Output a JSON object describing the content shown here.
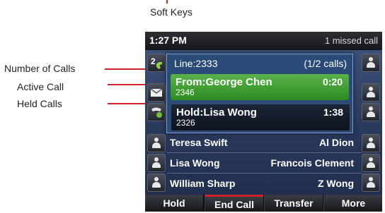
{
  "header": {
    "title": "Soft Keys"
  },
  "callouts": [
    {
      "label": "Number of Calls"
    },
    {
      "label": "Active Call"
    },
    {
      "label": "Held Calls"
    }
  ],
  "status": {
    "time": "1:27 PM",
    "missed": "1 missed call"
  },
  "line_badge": "2",
  "panel": {
    "line": "Line:2333",
    "calls": "(1/2 calls)",
    "active": {
      "name": "From:George Chen",
      "number": "2346",
      "time": "0:20"
    },
    "held": {
      "name": "Hold:Lisa Wong",
      "number": "2326",
      "time": "1:38"
    }
  },
  "contacts": [
    {
      "left": "Teresa Swift",
      "right": "Al Dion"
    },
    {
      "left": "Lisa Wong",
      "right": "Francois Clement"
    },
    {
      "left": "William Sharp",
      "right": "Z Wong"
    }
  ],
  "softkeys": [
    "Hold",
    "End Call",
    "Transfer",
    "More"
  ],
  "colors": {
    "callout": "#d2232a",
    "active_call": "#3f9e34",
    "held_call": "#141b29"
  }
}
